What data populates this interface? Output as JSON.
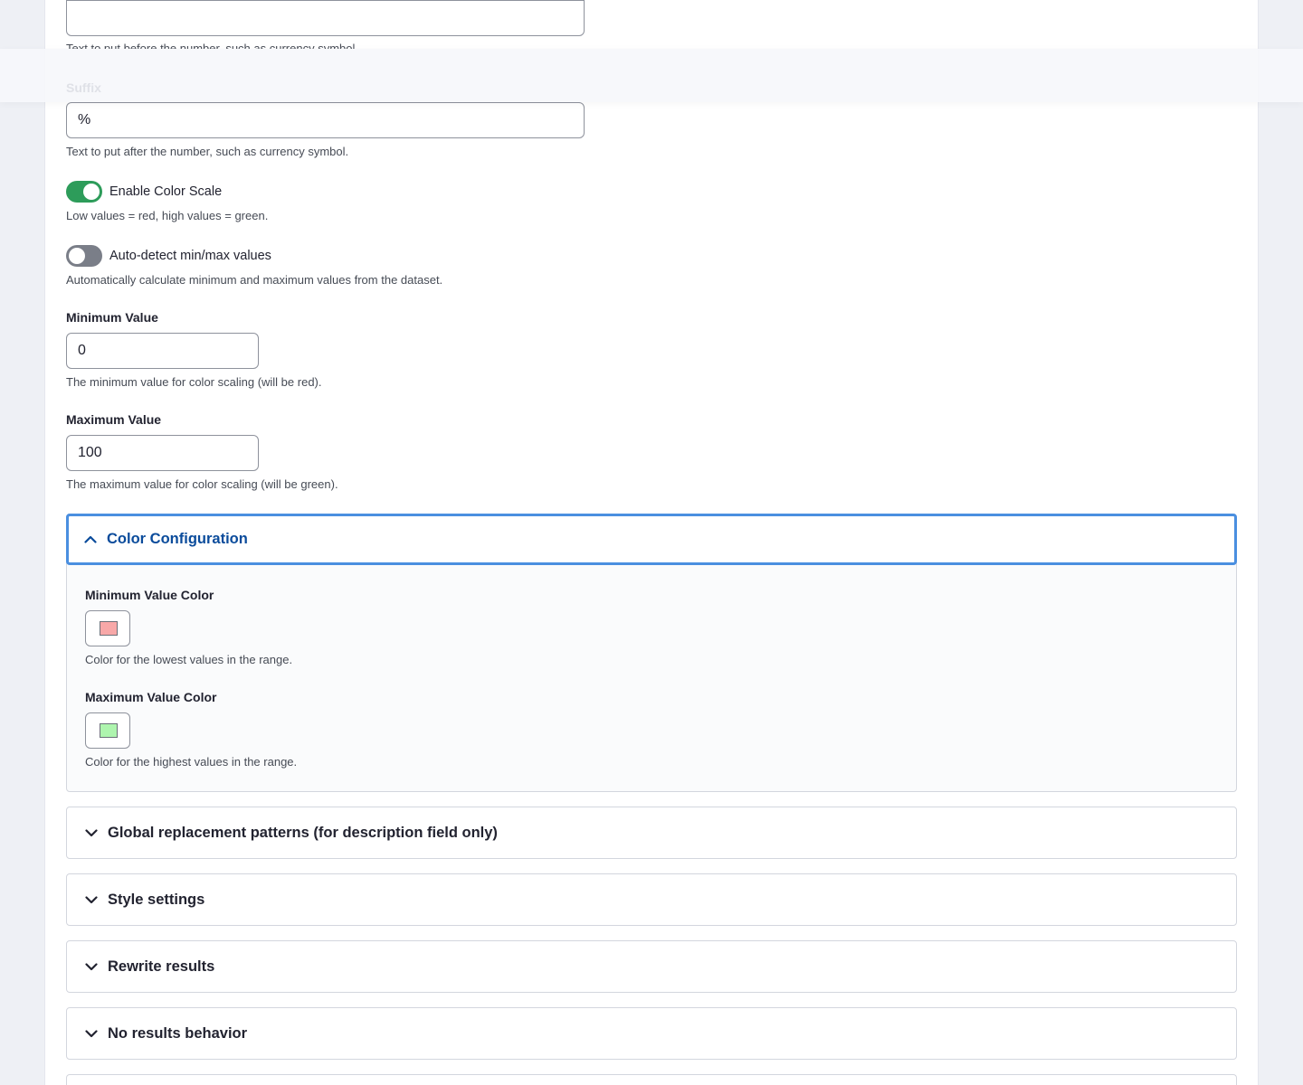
{
  "prefix": {
    "value": "",
    "description": "Text to put before the number, such as currency symbol."
  },
  "suffix": {
    "label": "Suffix",
    "value": "%",
    "description": "Text to put after the number, such as currency symbol."
  },
  "color_scale": {
    "label": "Enable Color Scale",
    "checked": true,
    "description": "Low values = red, high values = green."
  },
  "auto_detect": {
    "label": "Auto-detect min/max values",
    "checked": false,
    "description": "Automatically calculate minimum and maximum values from the dataset."
  },
  "minimum": {
    "label": "Minimum Value",
    "value": "0",
    "description": "The minimum value for color scaling (will be red)."
  },
  "maximum": {
    "label": "Maximum Value",
    "value": "100",
    "description": "The maximum value for color scaling (will be green)."
  },
  "color_config": {
    "title": "Color Configuration",
    "expanded": true,
    "min_color": {
      "label": "Minimum Value Color",
      "color": "#f8a8a8",
      "description": "Color for the lowest values in the range."
    },
    "max_color": {
      "label": "Maximum Value Color",
      "color": "#aef5ae",
      "description": "Color for the highest values in the range."
    }
  },
  "sections": [
    {
      "title": "Global replacement patterns (for description field only)",
      "icon": "chevron-down-icon"
    },
    {
      "title": "Style settings",
      "icon": "chevron-down-icon"
    },
    {
      "title": "Rewrite results",
      "icon": "chevron-down-icon"
    },
    {
      "title": "No results behavior",
      "icon": "chevron-down-icon"
    }
  ],
  "colors": {
    "accent": "#0a4b9b",
    "focus_border": "#4a8fe0",
    "toggle_on": "#2d9c5a",
    "toggle_off": "#7a7e88"
  }
}
